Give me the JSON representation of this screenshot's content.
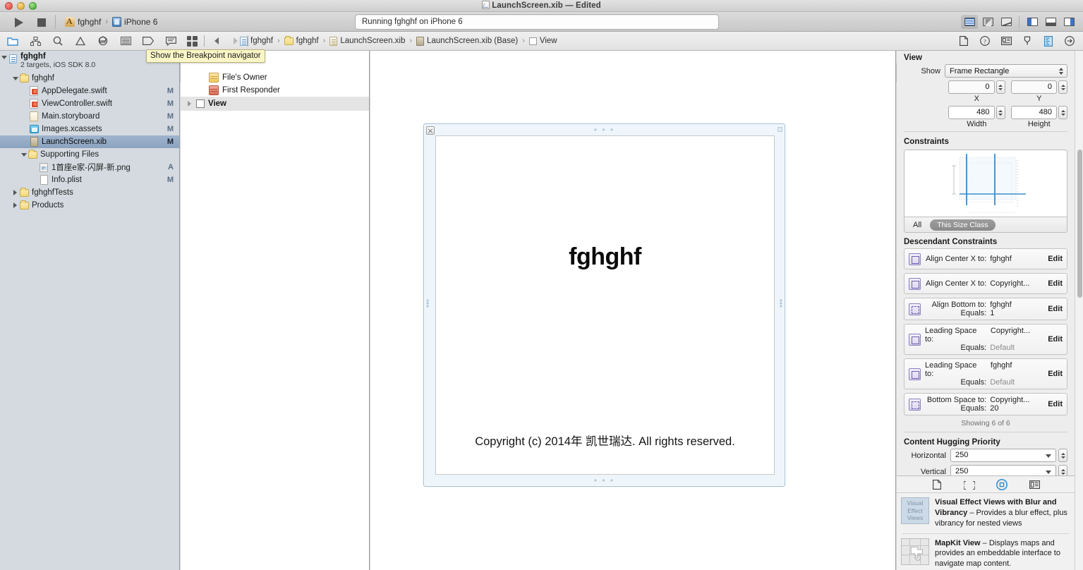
{
  "window": {
    "title": "LaunchScreen.xib — Edited",
    "doc_icon": "xib-icon"
  },
  "toolbar": {
    "run_label": "Run",
    "stop_label": "Stop",
    "scheme": "fghghf",
    "destination": "iPhone 6",
    "chevron": "›",
    "status": "Running fghghf on iPhone 6",
    "editor_buttons": [
      {
        "name": "standard-editor",
        "label": "Standard Editor",
        "selected": true
      },
      {
        "name": "assistant-editor",
        "label": "Assistant Editor",
        "selected": false
      },
      {
        "name": "version-editor",
        "label": "Version Editor",
        "selected": false
      }
    ],
    "view_buttons": [
      {
        "name": "navigator-toggle",
        "label": "Hide or show the Navigator",
        "selected": true
      },
      {
        "name": "debug-area-toggle",
        "label": "Hide or show the Debug area",
        "selected": false
      },
      {
        "name": "utilities-toggle",
        "label": "Hide or show the Utilities",
        "selected": true
      }
    ]
  },
  "navigator_tabs": [
    {
      "name": "project-navigator",
      "label": "Show the Project navigator",
      "selected": true
    },
    {
      "name": "symbol-navigator",
      "label": "Show the Symbol navigator",
      "selected": false
    },
    {
      "name": "find-navigator",
      "label": "Show the Find navigator",
      "selected": false
    },
    {
      "name": "issue-navigator",
      "label": "Show the Issue navigator",
      "selected": false
    },
    {
      "name": "test-navigator",
      "label": "Show the Test navigator",
      "selected": false
    },
    {
      "name": "debug-navigator",
      "label": "Show the Debug navigator",
      "selected": false
    },
    {
      "name": "breakpoint-navigator",
      "label": "Show the Breakpoint navigator",
      "selected": false
    },
    {
      "name": "report-navigator",
      "label": "Show the Report navigator",
      "selected": false
    }
  ],
  "tooltip": {
    "text": "Show the Breakpoint navigator"
  },
  "jump_bar": {
    "items": [
      {
        "label": "fghghf",
        "icon": "project-icon"
      },
      {
        "label": "fghghf",
        "icon": "folder-icon"
      },
      {
        "label": "LaunchScreen.xib",
        "icon": "xib-icon"
      },
      {
        "label": "LaunchScreen.xib (Base)",
        "icon": "xib-icon"
      },
      {
        "label": "View",
        "icon": "view-icon"
      }
    ],
    "separator": "›",
    "back_label": "Back",
    "forward_label": "Forward",
    "related_items_label": "Related Items"
  },
  "project_navigator": {
    "project": {
      "name": "fghghf",
      "subtitle": "2 targets, iOS SDK 8.0"
    },
    "items": [
      {
        "label": "fghghf",
        "icon": "folder-icon",
        "indent": 1,
        "disclosure": "open",
        "badge": ""
      },
      {
        "label": "AppDelegate.swift",
        "icon": "swift-icon",
        "indent": 2,
        "disclosure": "none",
        "badge": "M"
      },
      {
        "label": "ViewController.swift",
        "icon": "swift-icon",
        "indent": 2,
        "disclosure": "none",
        "badge": "M"
      },
      {
        "label": "Main.storyboard",
        "icon": "storyboard-icon",
        "indent": 2,
        "disclosure": "none",
        "badge": "M"
      },
      {
        "label": "Images.xcassets",
        "icon": "xcassets-icon",
        "indent": 2,
        "disclosure": "none",
        "badge": "M"
      },
      {
        "label": "LaunchScreen.xib",
        "icon": "xib-icon",
        "indent": 2,
        "disclosure": "none",
        "badge": "M",
        "selected": true
      },
      {
        "label": "Supporting Files",
        "icon": "folder-icon",
        "indent": 2,
        "disclosure": "open",
        "badge": ""
      },
      {
        "label": "1首座e家-闪屏-新.png",
        "icon": "png-icon",
        "indent": 3,
        "disclosure": "none",
        "badge": "A"
      },
      {
        "label": "Info.plist",
        "icon": "plist-icon",
        "indent": 3,
        "disclosure": "none",
        "badge": "M"
      },
      {
        "label": "fghghfTests",
        "icon": "folder-icon",
        "indent": 1,
        "disclosure": "closed",
        "badge": ""
      },
      {
        "label": "Products",
        "icon": "folder-icon",
        "indent": 1,
        "disclosure": "closed",
        "badge": ""
      }
    ]
  },
  "document_outline": {
    "items": [
      {
        "label": "File's Owner",
        "icon": "owner-cube-icon",
        "indent": 2,
        "disclosure": "none",
        "selected": false
      },
      {
        "label": "First Responder",
        "icon": "responder-cube-icon",
        "indent": 2,
        "disclosure": "none",
        "selected": false
      },
      {
        "label": "View",
        "icon": "view-icon",
        "indent": 0,
        "disclosure": "closed",
        "selected": true
      }
    ]
  },
  "canvas": {
    "screen_title": "fghghf",
    "copyright": "Copyright (c) 2014年 凯世瑞达. All rights reserved.",
    "dots": "• • •"
  },
  "inspector": {
    "tabs": [
      {
        "name": "file-inspector",
        "label": "File inspector",
        "selected": false
      },
      {
        "name": "quick-help-inspector",
        "label": "Quick Help inspector",
        "selected": false
      },
      {
        "name": "identity-inspector",
        "label": "Identity inspector",
        "selected": false
      },
      {
        "name": "attributes-inspector",
        "label": "Attributes inspector",
        "selected": false
      },
      {
        "name": "size-inspector",
        "label": "Size inspector",
        "selected": true
      },
      {
        "name": "connections-inspector",
        "label": "Connections inspector",
        "selected": false
      }
    ],
    "view_section": {
      "title": "View",
      "show_label": "Show",
      "show_value": "Frame Rectangle",
      "x_label": "X",
      "x_value": "0",
      "y_label": "Y",
      "y_value": "0",
      "width_label": "Width",
      "width_value": "480",
      "height_label": "Height",
      "height_value": "480"
    },
    "constraints_section": {
      "title": "Constraints",
      "scope_all": "All",
      "scope_size_class": "This Size Class"
    },
    "descendant_constraints": {
      "title": "Descendant Constraints",
      "edit_label": "Edit",
      "showing": "Showing 6 of 6",
      "items": [
        {
          "key": "Align Center X to:",
          "value": "fghghf",
          "icon": "align-center-x-icon"
        },
        {
          "key": "Align Center X to:",
          "value": "Copyright...",
          "icon": "align-center-x-icon"
        },
        {
          "key": "Align Bottom to:",
          "value": "fghghf",
          "icon": "align-bottom-icon",
          "key2": "Equals:",
          "value2": "1"
        },
        {
          "key": "Leading Space to:",
          "value": "Copyright...",
          "icon": "leading-space-icon",
          "key2": "Equals:",
          "value2": "Default",
          "muted2": true
        },
        {
          "key": "Leading Space to:",
          "value": "fghghf",
          "icon": "leading-space-icon",
          "key2": "Equals:",
          "value2": "Default",
          "muted2": true
        },
        {
          "key": "Bottom Space to:",
          "value": "Copyright...",
          "icon": "bottom-space-icon",
          "key2": "Equals:",
          "value2": "20"
        }
      ]
    },
    "content_hugging": {
      "title": "Content Hugging Priority",
      "horizontal_label": "Horizontal",
      "horizontal_value": "250",
      "vertical_label": "Vertical",
      "vertical_value": "250"
    }
  },
  "library": {
    "tabs": [
      {
        "name": "file-template-library",
        "label": "File Template Library",
        "selected": false
      },
      {
        "name": "code-snippet-library",
        "label": "Code Snippet Library",
        "selected": false
      },
      {
        "name": "object-library",
        "label": "Object Library",
        "selected": true
      },
      {
        "name": "media-library",
        "label": "Media Library",
        "selected": false
      }
    ],
    "items": [
      {
        "thumb_text": "Visual Effect Views",
        "title": "Visual Effect Views with Blur and Vibrancy",
        "desc": " – Provides a blur effect, plus vibrancy for nested views"
      },
      {
        "thumb_text": "",
        "title": "MapKit View",
        "desc": " – Displays maps and provides an embeddable interface to navigate map content."
      }
    ]
  },
  "colors": {
    "navigator_bg": "#d4dae0",
    "selection_blue": "#93a9c4",
    "accent_blue": "#3b74c4",
    "tooltip_yellow": "#fbf6c7",
    "constraint_purple": "#8b7fc0",
    "device_border": "#9fbdd6"
  }
}
